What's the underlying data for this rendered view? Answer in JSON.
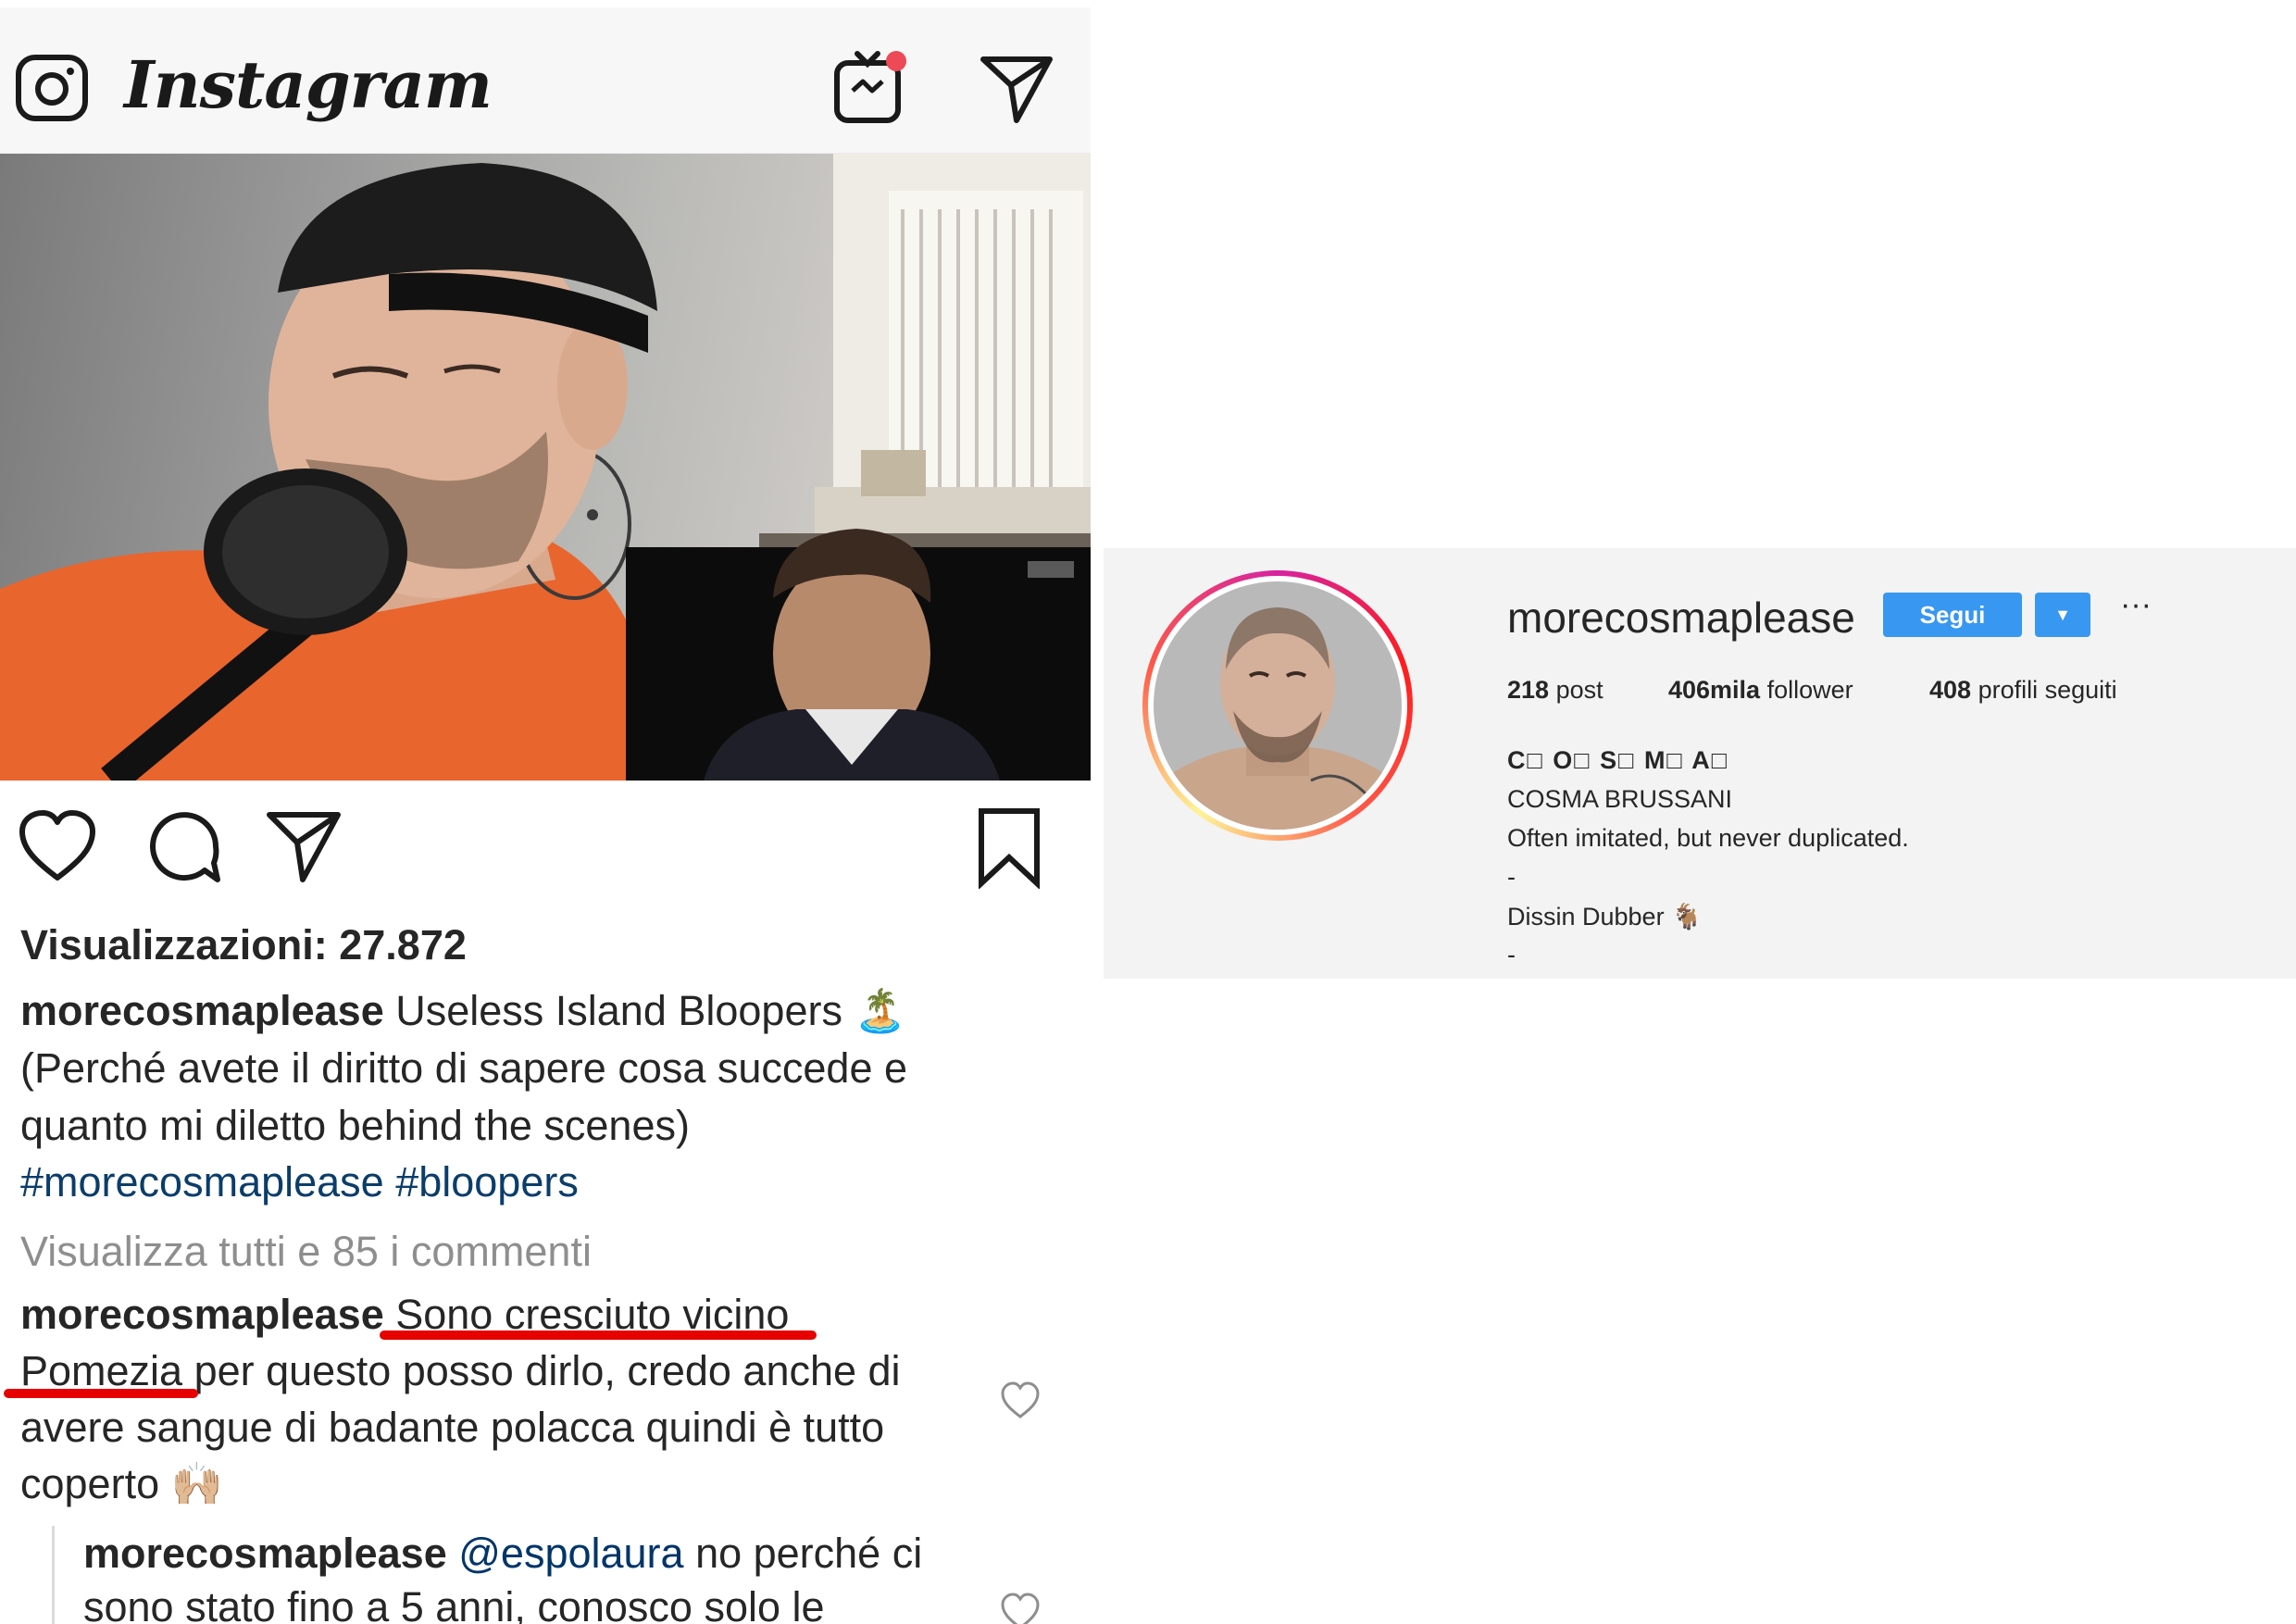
{
  "header": {
    "brand": "Instagram"
  },
  "post": {
    "views_label": "Visualizzazioni: 27.872",
    "caption": {
      "username": "morecosmaplease",
      "line1_text": " Useless Island Bloopers 🏝️",
      "line2": "(Perché avete il diritto di sapere cosa succede e",
      "line3": "quanto mi diletto behind the scenes)",
      "hashtags": "#morecosmaplease #bloopers"
    },
    "view_all_comments": "Visualizza tutti e 85 i commenti",
    "comments": [
      {
        "username": "morecosmaplease",
        "line1_text": " Sono cresciuto vicino",
        "line2_highlight": "Pomezia",
        "line2_rest": " per questo posso dirlo, credo anche di",
        "line3": "avere sangue di badante polacca quindi è tutto",
        "line4": "coperto 🙌🏼"
      },
      {
        "username": "morecosmaplease",
        "mention": "@espolaura",
        "line1_rest": " no perché ci",
        "line2": "sono stato fino a 5 anni, conosco solo le"
      }
    ]
  },
  "profile": {
    "username": "morecosmaplease",
    "follow_button": "Segui",
    "dropdown_symbol": "▼",
    "more_symbol": "···",
    "stats": {
      "posts_num": "218",
      "posts_label": " post",
      "followers_num": "406mila",
      "followers_label": " follower",
      "following_num": "408",
      "following_label": " profili seguiti"
    },
    "bio": {
      "styled_name": "C□  O□  S□  M□  A□",
      "full_name": "COSMA BRUSSANI",
      "tagline": "Often imitated, but never duplicated.",
      "dash1": "-",
      "role": "Dissin Dubber 🐐",
      "dash2": "-"
    }
  },
  "colors": {
    "accent_blue": "#3897f0",
    "underline_red": "#e60000",
    "hashtag": "#0b3d6b",
    "muted": "#8e8e8e"
  },
  "icons": [
    "camera-icon",
    "igtv-icon",
    "direct-icon",
    "heart-icon",
    "comment-icon",
    "share-icon",
    "bookmark-icon"
  ]
}
